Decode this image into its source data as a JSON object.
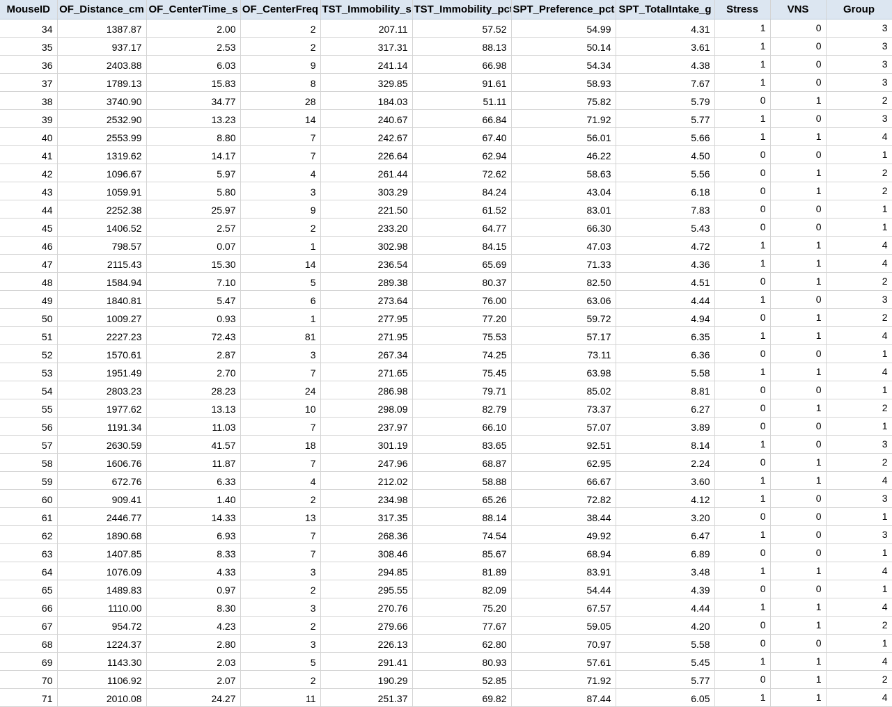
{
  "sheet": {
    "columns": [
      "MouseID",
      "OF_Distance_cm",
      "OF_CenterTime_s",
      "OF_CenterFreq",
      "TST_Immobility_s",
      "TST_Immobility_pct",
      "SPT_Preference_pct",
      "SPT_TotalIntake_g",
      "Stress",
      "VNS",
      "Group"
    ],
    "rows": [
      [
        "34",
        "1387.87",
        "2.00",
        "2",
        "207.11",
        "57.52",
        "54.99",
        "4.31",
        "1",
        "0",
        "3"
      ],
      [
        "35",
        "937.17",
        "2.53",
        "2",
        "317.31",
        "88.13",
        "50.14",
        "3.61",
        "1",
        "0",
        "3"
      ],
      [
        "36",
        "2403.88",
        "6.03",
        "9",
        "241.14",
        "66.98",
        "54.34",
        "4.38",
        "1",
        "0",
        "3"
      ],
      [
        "37",
        "1789.13",
        "15.83",
        "8",
        "329.85",
        "91.61",
        "58.93",
        "7.67",
        "1",
        "0",
        "3"
      ],
      [
        "38",
        "3740.90",
        "34.77",
        "28",
        "184.03",
        "51.11",
        "75.82",
        "5.79",
        "0",
        "1",
        "2"
      ],
      [
        "39",
        "2532.90",
        "13.23",
        "14",
        "240.67",
        "66.84",
        "71.92",
        "5.77",
        "1",
        "0",
        "3"
      ],
      [
        "40",
        "2553.99",
        "8.80",
        "7",
        "242.67",
        "67.40",
        "56.01",
        "5.66",
        "1",
        "1",
        "4"
      ],
      [
        "41",
        "1319.62",
        "14.17",
        "7",
        "226.64",
        "62.94",
        "46.22",
        "4.50",
        "0",
        "0",
        "1"
      ],
      [
        "42",
        "1096.67",
        "5.97",
        "4",
        "261.44",
        "72.62",
        "58.63",
        "5.56",
        "0",
        "1",
        "2"
      ],
      [
        "43",
        "1059.91",
        "5.80",
        "3",
        "303.29",
        "84.24",
        "43.04",
        "6.18",
        "0",
        "1",
        "2"
      ],
      [
        "44",
        "2252.38",
        "25.97",
        "9",
        "221.50",
        "61.52",
        "83.01",
        "7.83",
        "0",
        "0",
        "1"
      ],
      [
        "45",
        "1406.52",
        "2.57",
        "2",
        "233.20",
        "64.77",
        "66.30",
        "5.43",
        "0",
        "0",
        "1"
      ],
      [
        "46",
        "798.57",
        "0.07",
        "1",
        "302.98",
        "84.15",
        "47.03",
        "4.72",
        "1",
        "1",
        "4"
      ],
      [
        "47",
        "2115.43",
        "15.30",
        "14",
        "236.54",
        "65.69",
        "71.33",
        "4.36",
        "1",
        "1",
        "4"
      ],
      [
        "48",
        "1584.94",
        "7.10",
        "5",
        "289.38",
        "80.37",
        "82.50",
        "4.51",
        "0",
        "1",
        "2"
      ],
      [
        "49",
        "1840.81",
        "5.47",
        "6",
        "273.64",
        "76.00",
        "63.06",
        "4.44",
        "1",
        "0",
        "3"
      ],
      [
        "50",
        "1009.27",
        "0.93",
        "1",
        "277.95",
        "77.20",
        "59.72",
        "4.94",
        "0",
        "1",
        "2"
      ],
      [
        "51",
        "2227.23",
        "72.43",
        "81",
        "271.95",
        "75.53",
        "57.17",
        "6.35",
        "1",
        "1",
        "4"
      ],
      [
        "52",
        "1570.61",
        "2.87",
        "3",
        "267.34",
        "74.25",
        "73.11",
        "6.36",
        "0",
        "0",
        "1"
      ],
      [
        "53",
        "1951.49",
        "2.70",
        "7",
        "271.65",
        "75.45",
        "63.98",
        "5.58",
        "1",
        "1",
        "4"
      ],
      [
        "54",
        "2803.23",
        "28.23",
        "24",
        "286.98",
        "79.71",
        "85.02",
        "8.81",
        "0",
        "0",
        "1"
      ],
      [
        "55",
        "1977.62",
        "13.13",
        "10",
        "298.09",
        "82.79",
        "73.37",
        "6.27",
        "0",
        "1",
        "2"
      ],
      [
        "56",
        "1191.34",
        "11.03",
        "7",
        "237.97",
        "66.10",
        "57.07",
        "3.89",
        "0",
        "0",
        "1"
      ],
      [
        "57",
        "2630.59",
        "41.57",
        "18",
        "301.19",
        "83.65",
        "92.51",
        "8.14",
        "1",
        "0",
        "3"
      ],
      [
        "58",
        "1606.76",
        "11.87",
        "7",
        "247.96",
        "68.87",
        "62.95",
        "2.24",
        "0",
        "1",
        "2"
      ],
      [
        "59",
        "672.76",
        "6.33",
        "4",
        "212.02",
        "58.88",
        "66.67",
        "3.60",
        "1",
        "1",
        "4"
      ],
      [
        "60",
        "909.41",
        "1.40",
        "2",
        "234.98",
        "65.26",
        "72.82",
        "4.12",
        "1",
        "0",
        "3"
      ],
      [
        "61",
        "2446.77",
        "14.33",
        "13",
        "317.35",
        "88.14",
        "38.44",
        "3.20",
        "0",
        "0",
        "1"
      ],
      [
        "62",
        "1890.68",
        "6.93",
        "7",
        "268.36",
        "74.54",
        "49.92",
        "6.47",
        "1",
        "0",
        "3"
      ],
      [
        "63",
        "1407.85",
        "8.33",
        "7",
        "308.46",
        "85.67",
        "68.94",
        "6.89",
        "0",
        "0",
        "1"
      ],
      [
        "64",
        "1076.09",
        "4.33",
        "3",
        "294.85",
        "81.89",
        "83.91",
        "3.48",
        "1",
        "1",
        "4"
      ],
      [
        "65",
        "1489.83",
        "0.97",
        "2",
        "295.55",
        "82.09",
        "54.44",
        "4.39",
        "0",
        "0",
        "1"
      ],
      [
        "66",
        "1110.00",
        "8.30",
        "3",
        "270.76",
        "75.20",
        "67.57",
        "4.44",
        "1",
        "1",
        "4"
      ],
      [
        "67",
        "954.72",
        "4.23",
        "2",
        "279.66",
        "77.67",
        "59.05",
        "4.20",
        "0",
        "1",
        "2"
      ],
      [
        "68",
        "1224.37",
        "2.80",
        "3",
        "226.13",
        "62.80",
        "70.97",
        "5.58",
        "0",
        "0",
        "1"
      ],
      [
        "69",
        "1143.30",
        "2.03",
        "5",
        "291.41",
        "80.93",
        "57.61",
        "5.45",
        "1",
        "1",
        "4"
      ],
      [
        "70",
        "1106.92",
        "2.07",
        "2",
        "190.29",
        "52.85",
        "71.92",
        "5.77",
        "0",
        "1",
        "2"
      ],
      [
        "71",
        "2010.08",
        "24.27",
        "11",
        "251.37",
        "69.82",
        "87.44",
        "6.05",
        "1",
        "1",
        "4"
      ]
    ]
  },
  "colors": {
    "header_background": "#dce6f1",
    "grid_line": "#d4d4d4",
    "text": "#000000"
  }
}
